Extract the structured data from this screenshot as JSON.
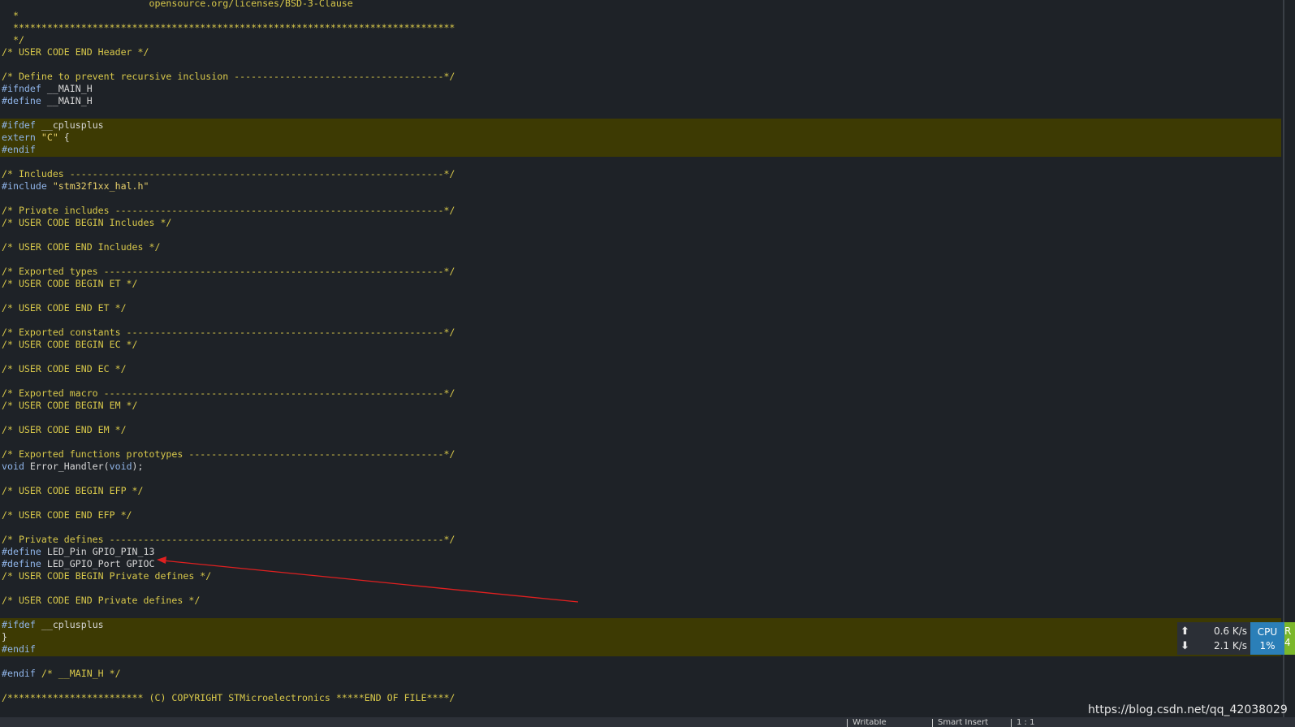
{
  "editor": {
    "lines": [
      {
        "row": 0,
        "parts": [
          {
            "c": "cm",
            "t": "                          opensource.org/licenses/BSD-3-Clause"
          }
        ]
      },
      {
        "row": 1,
        "parts": [
          {
            "c": "cm",
            "t": "  *"
          }
        ]
      },
      {
        "row": 2,
        "parts": [
          {
            "c": "cm",
            "t": "  ******************************************************************************"
          }
        ]
      },
      {
        "row": 3,
        "parts": [
          {
            "c": "cm",
            "t": "  */"
          }
        ]
      },
      {
        "row": 4,
        "parts": [
          {
            "c": "cm",
            "t": "/* USER CODE END Header */"
          }
        ]
      },
      {
        "row": 6,
        "parts": [
          {
            "c": "cm",
            "t": "/* Define to prevent recursive inclusion -------------------------------------*/"
          }
        ]
      },
      {
        "row": 7,
        "parts": [
          {
            "c": "kw",
            "t": "#ifndef"
          },
          {
            "c": "txt",
            "t": " __MAIN_H"
          }
        ]
      },
      {
        "row": 8,
        "parts": [
          {
            "c": "kw",
            "t": "#define"
          },
          {
            "c": "txt",
            "t": " __MAIN_H"
          }
        ]
      },
      {
        "row": 10,
        "parts": [
          {
            "c": "kw",
            "t": "#ifdef"
          },
          {
            "c": "txt",
            "t": " __cplusplus"
          }
        ]
      },
      {
        "row": 11,
        "parts": [
          {
            "c": "kw",
            "t": "extern"
          },
          {
            "c": "txt",
            "t": " "
          },
          {
            "c": "str",
            "t": "\"C\""
          },
          {
            "c": "txt",
            "t": " {"
          }
        ]
      },
      {
        "row": 12,
        "parts": [
          {
            "c": "kw",
            "t": "#endif"
          }
        ]
      },
      {
        "row": 14,
        "parts": [
          {
            "c": "cm",
            "t": "/* Includes ------------------------------------------------------------------*/"
          }
        ]
      },
      {
        "row": 15,
        "parts": [
          {
            "c": "kw",
            "t": "#include"
          },
          {
            "c": "txt",
            "t": " "
          },
          {
            "c": "str",
            "t": "\"stm32f1xx_hal.h\""
          }
        ]
      },
      {
        "row": 17,
        "parts": [
          {
            "c": "cm",
            "t": "/* Private includes ----------------------------------------------------------*/"
          }
        ]
      },
      {
        "row": 18,
        "parts": [
          {
            "c": "cm",
            "t": "/* USER CODE BEGIN Includes */"
          }
        ]
      },
      {
        "row": 20,
        "parts": [
          {
            "c": "cm",
            "t": "/* USER CODE END Includes */"
          }
        ]
      },
      {
        "row": 22,
        "parts": [
          {
            "c": "cm",
            "t": "/* Exported types ------------------------------------------------------------*/"
          }
        ]
      },
      {
        "row": 23,
        "parts": [
          {
            "c": "cm",
            "t": "/* USER CODE BEGIN ET */"
          }
        ]
      },
      {
        "row": 25,
        "parts": [
          {
            "c": "cm",
            "t": "/* USER CODE END ET */"
          }
        ]
      },
      {
        "row": 27,
        "parts": [
          {
            "c": "cm",
            "t": "/* Exported constants --------------------------------------------------------*/"
          }
        ]
      },
      {
        "row": 28,
        "parts": [
          {
            "c": "cm",
            "t": "/* USER CODE BEGIN EC */"
          }
        ]
      },
      {
        "row": 30,
        "parts": [
          {
            "c": "cm",
            "t": "/* USER CODE END EC */"
          }
        ]
      },
      {
        "row": 32,
        "parts": [
          {
            "c": "cm",
            "t": "/* Exported macro ------------------------------------------------------------*/"
          }
        ]
      },
      {
        "row": 33,
        "parts": [
          {
            "c": "cm",
            "t": "/* USER CODE BEGIN EM */"
          }
        ]
      },
      {
        "row": 35,
        "parts": [
          {
            "c": "cm",
            "t": "/* USER CODE END EM */"
          }
        ]
      },
      {
        "row": 37,
        "parts": [
          {
            "c": "cm",
            "t": "/* Exported functions prototypes ---------------------------------------------*/"
          }
        ]
      },
      {
        "row": 38,
        "parts": [
          {
            "c": "kw",
            "t": "void"
          },
          {
            "c": "txt",
            "t": " Error_Handler("
          },
          {
            "c": "kw",
            "t": "void"
          },
          {
            "c": "txt",
            "t": ");"
          }
        ]
      },
      {
        "row": 40,
        "parts": [
          {
            "c": "cm",
            "t": "/* USER CODE BEGIN EFP */"
          }
        ]
      },
      {
        "row": 42,
        "parts": [
          {
            "c": "cm",
            "t": "/* USER CODE END EFP */"
          }
        ]
      },
      {
        "row": 44,
        "parts": [
          {
            "c": "cm",
            "t": "/* Private defines -----------------------------------------------------------*/"
          }
        ]
      },
      {
        "row": 45,
        "parts": [
          {
            "c": "kw",
            "t": "#define"
          },
          {
            "c": "txt",
            "t": " LED_Pin GPIO_PIN_13"
          }
        ]
      },
      {
        "row": 46,
        "parts": [
          {
            "c": "kw",
            "t": "#define"
          },
          {
            "c": "txt",
            "t": " LED_GPIO_Port GPIOC"
          }
        ]
      },
      {
        "row": 47,
        "parts": [
          {
            "c": "cm",
            "t": "/* USER CODE BEGIN Private defines */"
          }
        ]
      },
      {
        "row": 49,
        "parts": [
          {
            "c": "cm",
            "t": "/* USER CODE END Private defines */"
          }
        ]
      },
      {
        "row": 51,
        "parts": [
          {
            "c": "kw",
            "t": "#ifdef"
          },
          {
            "c": "txt",
            "t": " __cplusplus"
          }
        ]
      },
      {
        "row": 52,
        "parts": [
          {
            "c": "txt",
            "t": "}"
          }
        ]
      },
      {
        "row": 53,
        "parts": [
          {
            "c": "kw",
            "t": "#endif"
          }
        ]
      },
      {
        "row": 55,
        "parts": [
          {
            "c": "kw",
            "t": "#endif"
          },
          {
            "c": "cm",
            "t": " /* __MAIN_H */"
          }
        ]
      },
      {
        "row": 57,
        "parts": [
          {
            "c": "cm",
            "t": "/************************ (C) COPYRIGHT STMicroelectronics *****END OF FILE****/"
          }
        ]
      }
    ],
    "highlight_blocks": [
      [
        10,
        12
      ],
      [
        51,
        53
      ]
    ],
    "highlight_color": "#3d3a03",
    "annotation_color": "#e02020"
  },
  "net_monitor": {
    "upload_icon": "arrow-up-icon",
    "download_icon": "arrow-down-icon",
    "upload": "0.6 K/s",
    "download": "2.1 K/s",
    "cpu_label": "CPU",
    "cpu_value": "1%",
    "cpu_color": "#2b7fb8",
    "extra_label": "R",
    "extra_value": "4",
    "extra_color": "#7bb72b"
  },
  "status_bar": {
    "items": [
      "Writable",
      "Smart Insert",
      "1 : 1"
    ]
  },
  "watermark": "https://blog.csdn.net/qq_42038029"
}
